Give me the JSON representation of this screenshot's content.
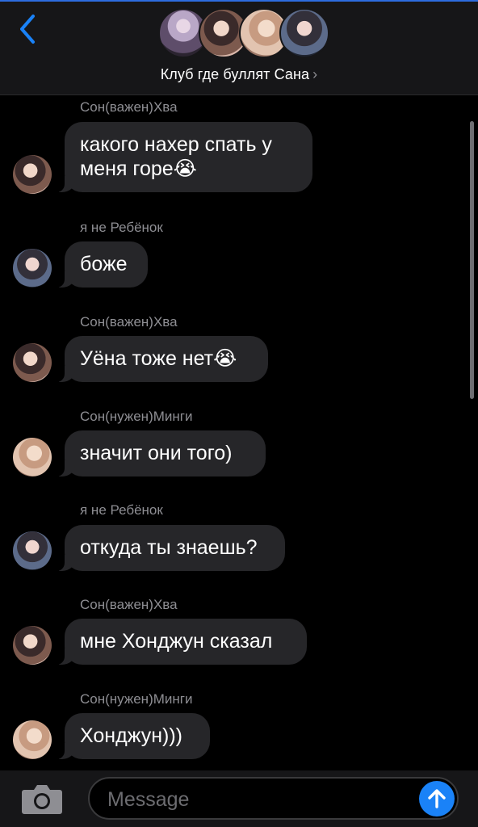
{
  "colors": {
    "accent": "#1a82f7",
    "bubble": "#262629",
    "header_bg": "#161618",
    "sender_name": "#8e8e93"
  },
  "header": {
    "back_icon": "chevron-left-icon",
    "title": "Клуб где буллят Сана",
    "title_chevron": "›"
  },
  "messages": [
    {
      "sender": "Сон(важен)Хва",
      "text": "какого нахер спать у меня горе",
      "emoji": "😭"
    },
    {
      "sender": "я не Ребёнок",
      "text": "боже",
      "emoji": ""
    },
    {
      "sender": "Сон(важен)Хва",
      "text": "Уёна тоже нет",
      "emoji": "😭"
    },
    {
      "sender": "Сон(нужен)Минги",
      "text": "значит они того)",
      "emoji": ""
    },
    {
      "sender": "я не Ребёнок",
      "text": "откуда ты знаешь?",
      "emoji": ""
    },
    {
      "sender": "Сон(важен)Хва",
      "text": "мне Хонджун сказал",
      "emoji": ""
    },
    {
      "sender": "Сон(нужен)Минги",
      "text": "Хонджун)))",
      "emoji": ""
    }
  ],
  "composer": {
    "placeholder": "Message",
    "camera_icon": "camera-icon",
    "send_icon": "arrow-up-icon"
  }
}
